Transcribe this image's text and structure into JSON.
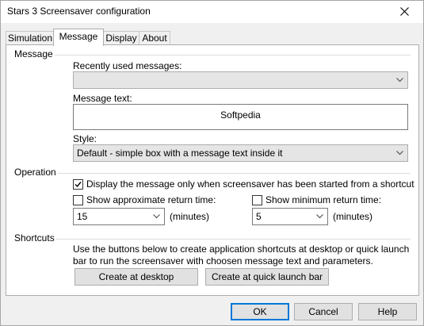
{
  "window": {
    "title": "Stars 3 Screensaver configuration"
  },
  "tabs": [
    {
      "label": "Simulation"
    },
    {
      "label": "Message"
    },
    {
      "label": "Display"
    },
    {
      "label": "About"
    }
  ],
  "active_tab": "Message",
  "message_group": {
    "label": "Message",
    "recent_label": "Recently used messages:",
    "recent_value": "",
    "text_label": "Message text:",
    "text_value": "Softpedia",
    "style_label": "Style:",
    "style_value": "Default - simple box with a message text inside it"
  },
  "operation_group": {
    "label": "Operation",
    "only_shortcut_label": "Display the message only when screensaver has been started from a shortcut",
    "only_shortcut_checked": true,
    "approx_label": "Show approximate return time:",
    "approx_checked": false,
    "approx_value": "15",
    "approx_unit": "(minutes)",
    "min_label": "Show minimum return time:",
    "min_checked": false,
    "min_value": "5",
    "min_unit": "(minutes)"
  },
  "shortcuts_group": {
    "label": "Shortcuts",
    "description": "Use the buttons below to create application shortcuts at desktop or quick launch bar to run the screensaver with choosen message text and parameters.",
    "desktop_button": "Create at desktop",
    "quicklaunch_button": "Create at quick launch bar"
  },
  "footer": {
    "ok": "OK",
    "cancel": "Cancel",
    "help": "Help"
  },
  "colors": {
    "accent": "#0078d7",
    "panel": "#ffffff",
    "window": "#f0f0f0"
  }
}
